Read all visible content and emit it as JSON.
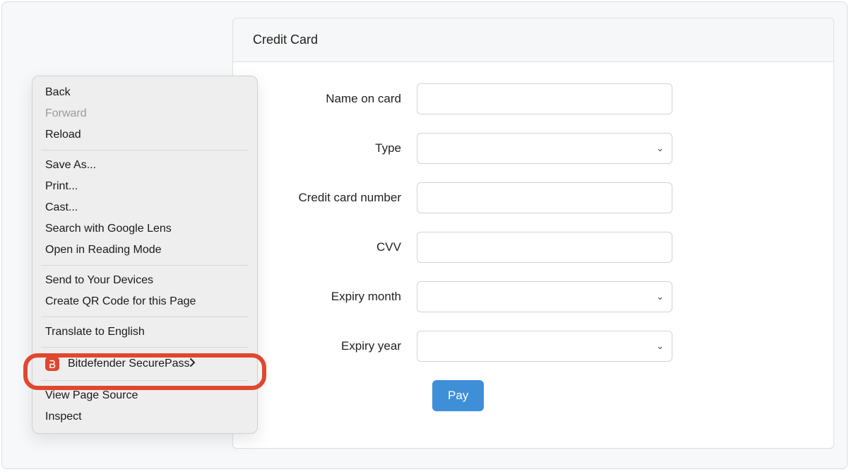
{
  "panel": {
    "title": "Credit Card",
    "fields": {
      "name_label": "Name on card",
      "type_label": "Type",
      "number_label": "Credit card number",
      "cvv_label": "CVV",
      "month_label": "Expiry month",
      "year_label": "Expiry year"
    },
    "values": {
      "name": "",
      "type": "",
      "number": "",
      "cvv": "",
      "month": "",
      "year": ""
    },
    "pay_label": "Pay"
  },
  "context_menu": {
    "back": "Back",
    "forward": "Forward",
    "reload": "Reload",
    "save_as": "Save As...",
    "print": "Print...",
    "cast": "Cast...",
    "search_lens": "Search with Google Lens",
    "reading_mode": "Open in Reading Mode",
    "send_devices": "Send to Your Devices",
    "create_qr": "Create QR Code for this Page",
    "translate": "Translate to English",
    "securepass": "Bitdefender SecurePass",
    "view_source": "View Page Source",
    "inspect": "Inspect"
  }
}
